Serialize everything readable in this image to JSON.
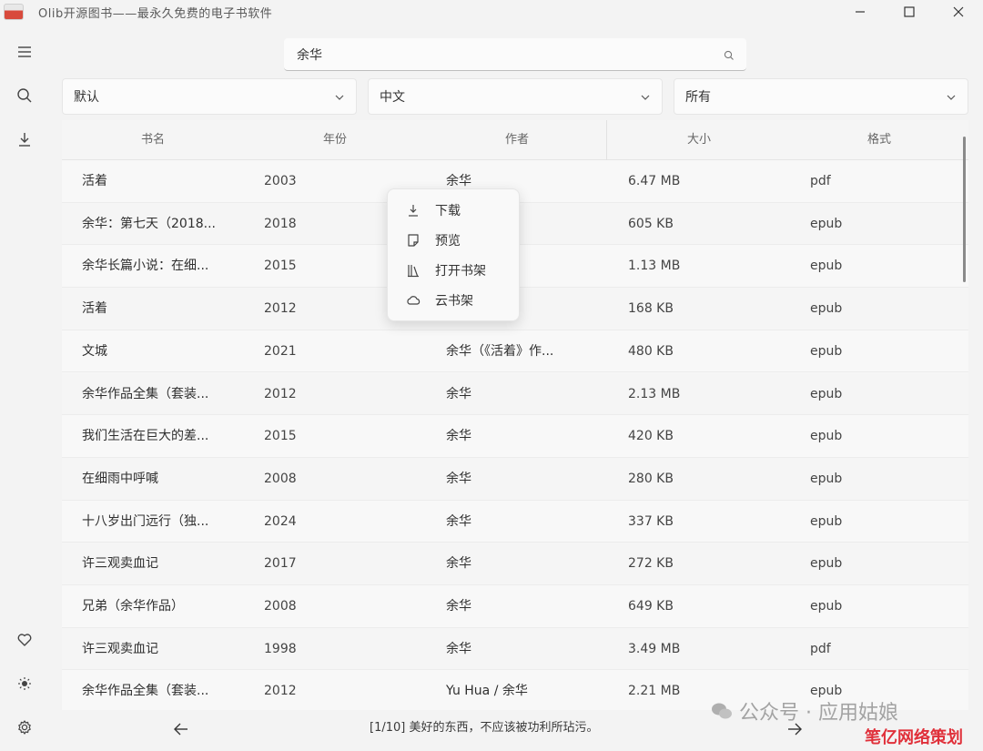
{
  "window": {
    "title": "Olib开源图书——最永久免费的电子书软件"
  },
  "search": {
    "value": "余华",
    "placeholder": ""
  },
  "filters": {
    "sort": "默认",
    "language": "中文",
    "format": "所有"
  },
  "table": {
    "headers": {
      "name": "书名",
      "year": "年份",
      "author": "作者",
      "size": "大小",
      "format": "格式"
    },
    "rows": [
      {
        "name": "活着",
        "year": "2003",
        "author": "余华",
        "size": "6.47 MB",
        "format": "pdf"
      },
      {
        "name": "余华：第七天（2018...",
        "year": "2018",
        "author": "",
        "size": "605 KB",
        "format": "epub"
      },
      {
        "name": "余华长篇小说：在细...",
        "year": "2015",
        "author": "",
        "size": "1.13 MB",
        "format": "epub"
      },
      {
        "name": "活着",
        "year": "2012",
        "author": "",
        "size": "168 KB",
        "format": "epub"
      },
      {
        "name": "文城",
        "year": "2021",
        "author": "余华（《活着》作...",
        "size": "480 KB",
        "format": "epub"
      },
      {
        "name": "余华作品全集（套装...",
        "year": "2012",
        "author": "余华",
        "size": "2.13 MB",
        "format": "epub"
      },
      {
        "name": "我们生活在巨大的差...",
        "year": "2015",
        "author": "余华",
        "size": "420 KB",
        "format": "epub"
      },
      {
        "name": "在细雨中呼喊",
        "year": "2008",
        "author": "余华",
        "size": "280 KB",
        "format": "epub"
      },
      {
        "name": "十八岁出门远行（独...",
        "year": "2024",
        "author": "余华",
        "size": "337 KB",
        "format": "epub"
      },
      {
        "name": "许三观卖血记",
        "year": "2017",
        "author": "余华",
        "size": "272 KB",
        "format": "epub"
      },
      {
        "name": "兄弟（余华作品）",
        "year": "2008",
        "author": "余华",
        "size": "649 KB",
        "format": "epub"
      },
      {
        "name": "许三观卖血记",
        "year": "1998",
        "author": "余华",
        "size": "3.49 MB",
        "format": "pdf"
      },
      {
        "name": "余华作品全集（套装...",
        "year": "2012",
        "author": "Yu Hua / 余华",
        "size": "2.21 MB",
        "format": "epub"
      }
    ]
  },
  "context_menu": {
    "items": [
      {
        "label": "下载",
        "icon": "download-icon"
      },
      {
        "label": "预览",
        "icon": "preview-icon"
      },
      {
        "label": "打开书架",
        "icon": "bookshelf-icon"
      },
      {
        "label": "云书架",
        "icon": "cloud-icon"
      }
    ]
  },
  "footer": {
    "text": "[1/10] 美好的东西，不应该被功利所玷污。"
  },
  "watermark": {
    "text": "公众号 · 应用姑娘",
    "site": "笔亿网络策划"
  }
}
